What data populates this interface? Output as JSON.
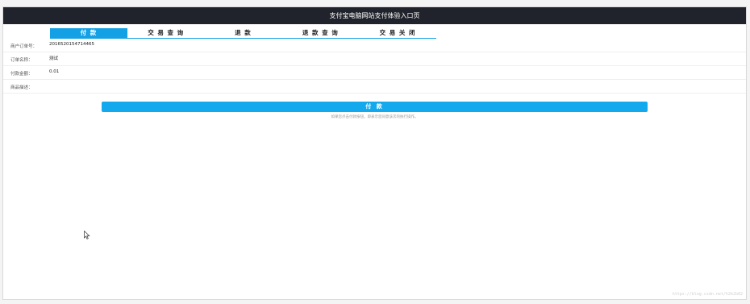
{
  "header": {
    "title": "支付宝电脑网站支付体验入口页"
  },
  "tabs": [
    {
      "label": "付 款"
    },
    {
      "label": "交 易 查 询"
    },
    {
      "label": "退 款"
    },
    {
      "label": "退 款 查 询"
    },
    {
      "label": "交 易 关 闭"
    }
  ],
  "form": {
    "order_no": {
      "label": "商户订单号：",
      "value": "2016520154714465"
    },
    "order_name": {
      "label": "订单名称：",
      "value": "测试"
    },
    "amount": {
      "label": "付款金额：",
      "value": "0.01"
    },
    "description": {
      "label": "商品描述：",
      "value": ""
    }
  },
  "pay_button": {
    "label": "付 款"
  },
  "hint": "如果您点击付款按钮，即表示您同意该次的执行操作。",
  "watermark": "https://blog.csdn.net/h2b2b02"
}
